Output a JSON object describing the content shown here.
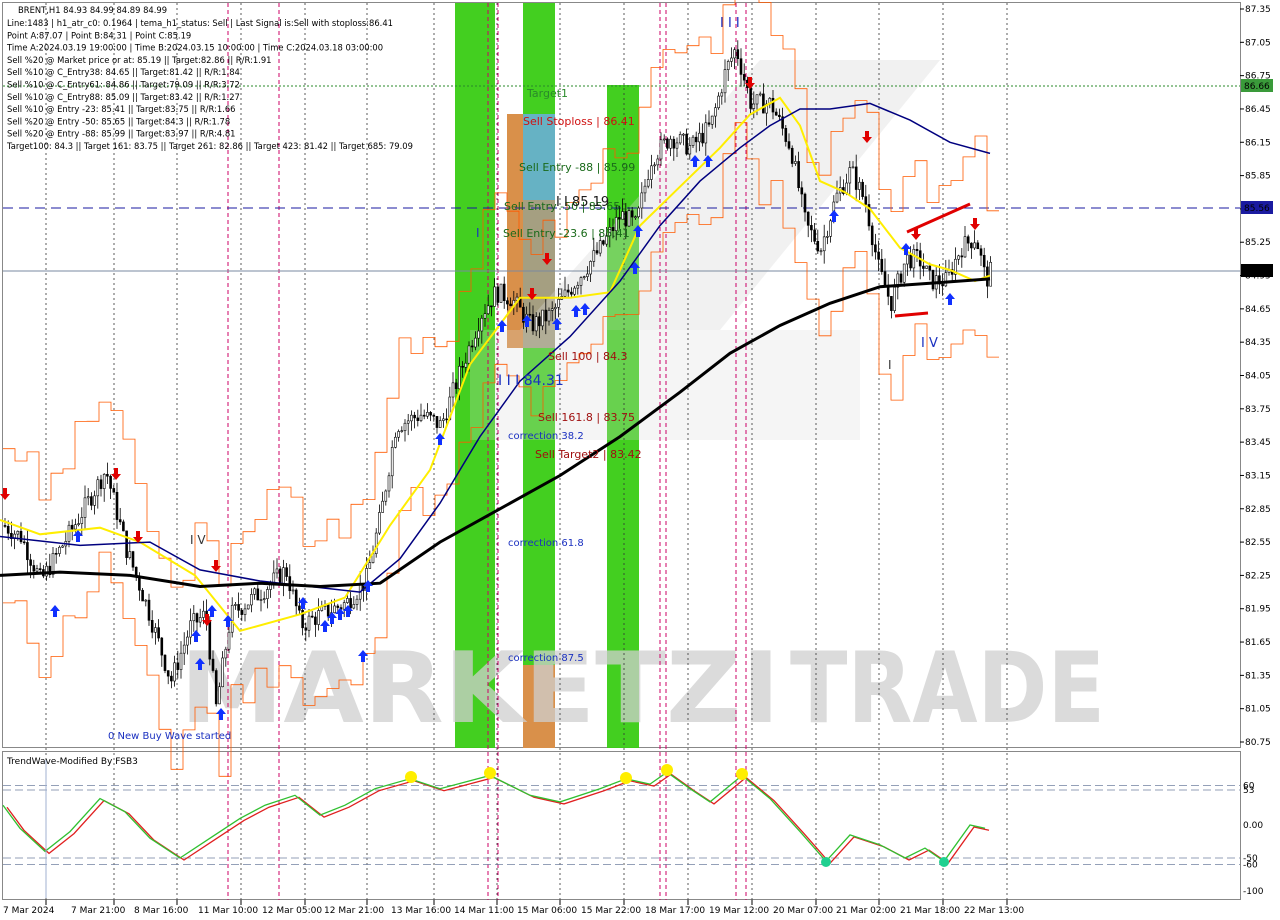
{
  "header": {
    "symbol": "BRENT,H1  84.93 84.99 84.89 84.99",
    "lines": [
      "Line:1483  |  h1_atr_c0: 0.1964  |  tema_h1_status: Sell  |  Last Signal is:Sell with stoploss:86.41",
      "Point A:87.07  |  Point B:84.31  |  Point C:85.19",
      "Time A:2024.03.19 19:00:00  |  Time B:2024.03.15 10:00:00  |  Time C:2024.03.18 03:00:00",
      "Sell %20 @ Market price or at: 85.19  ||  Target:82.86  ||  R/R:1.91",
      "Sell %10 @ C_Entry38: 84.65  ||  Target:81.42  ||  R/R:1.84",
      "Sell %10 @ C_Entry61: 84.86  ||  Target:79.09  ||  R/R:3.72",
      "Sell %10 @ C_Entry88: 85.09  ||  Target:83.42  ||  R/R:1.27",
      "Sell %10 @ Entry -23: 85.41  ||  Target:83.75  ||  R/R:1.66",
      "Sell %20 @ Entry -50: 85.65  ||  Target:84.3  ||  R/R:1.78",
      "Sell %20 @ Entry -88: 85.99  ||  Target:83.97  ||  R/R:4.81",
      "Target100: 84.3  ||  Target 161: 83.75  ||  Target 261: 82.86  ||  Target 423: 81.42  ||  Target 685: 79.09"
    ]
  },
  "watermark": {
    "left": "MARKETZI",
    "right": "TRADE"
  },
  "price_axis": {
    "ticks": [
      "87.35",
      "87.05",
      "86.75",
      "86.45",
      "86.15",
      "85.85",
      "85.55",
      "85.25",
      "84.95",
      "84.65",
      "84.35",
      "84.05",
      "83.75",
      "83.45",
      "83.15",
      "82.85",
      "82.55",
      "82.25",
      "81.95",
      "81.65",
      "81.35",
      "81.05",
      "80.75"
    ],
    "current_price": "84.99",
    "target_level": "86.66",
    "dashed_level": "85.56"
  },
  "time_axis": {
    "labels": [
      "7 Mar 2024",
      "7 Mar 21:00",
      "8 Mar 16:00",
      "11 Mar 10:00",
      "12 Mar 05:00",
      "12 Mar 21:00",
      "13 Mar 16:00",
      "14 Mar 11:00",
      "15 Mar 06:00",
      "15 Mar 22:00",
      "18 Mar 17:00",
      "19 Mar 12:00",
      "20 Mar 07:00",
      "21 Mar 02:00",
      "21 Mar 18:00",
      "22 Mar 13:00"
    ]
  },
  "annotations": {
    "target1": "Target1",
    "sell_stoploss": "Sell Stoploss | 86.41",
    "sell_entry_88": "Sell Entry -88 | 85.99",
    "sell_entry_50": "Sell Entry -50 | 85.65",
    "level_c": "I I 85.19",
    "sell_entry_23": "Sell Entry -23.6 | 85.41",
    "sell_100": "Sell 100 | 84.3",
    "level_b": "I I I 84.31",
    "sell_161": "Sell 161.8 | 83.75",
    "correction_38": "correction 38.2",
    "sell_target2": "Sell Target2 | 83.42",
    "correction_61": "correction 61.8",
    "correction_87": "correction 87.5",
    "new_buy_wave": "0 New Buy Wave started",
    "wave_iii": "I I I",
    "wave_iv": "I V",
    "wave_iv_left": "I V",
    "wave_i": "I",
    "wave_i2": "I"
  },
  "oscillator": {
    "title": "TrendWave-Modified By FSB3",
    "ticks": [
      "60",
      "53",
      "0.00",
      "-50",
      "-60",
      "-100"
    ]
  },
  "colors": {
    "green_band": "#39cc14",
    "orange_band": "#d9904a",
    "blue_band": "#6aaed6",
    "ma_yellow": "#ffee00",
    "ma_navy": "#00007f",
    "ma_black": "#000000",
    "envelope": "#ff5a00",
    "up_arrow": "#1030ff",
    "down_arrow": "#e00000"
  },
  "chart_data": {
    "type": "candlestick",
    "symbol": "BRENT",
    "timeframe": "H1",
    "ylim": [
      80.7,
      87.4
    ],
    "anchors": [
      [
        "7 Mar 2024",
        82.7
      ],
      [
        "7 Mar 21:00",
        82.55
      ],
      [
        "8 Mar 16:00",
        82.3
      ],
      [
        "11 Mar 10:00",
        81.4
      ],
      [
        "12 Mar 05:00",
        82.2
      ],
      [
        "12 Mar 21:00",
        82.1
      ],
      [
        "13 Mar 16:00",
        83.8
      ],
      [
        "14 Mar 11:00",
        84.9
      ],
      [
        "15 Mar 06:00",
        84.4
      ],
      [
        "15 Mar 22:00",
        85.2
      ],
      [
        "18 Mar 17:00",
        86.1
      ],
      [
        "19 Mar 12:00",
        86.6
      ],
      [
        "20 Mar 07:00",
        85.4
      ],
      [
        "21 Mar 02:00",
        85.6
      ],
      [
        "21 Mar 18:00",
        84.8
      ],
      [
        "22 Mar 13:00",
        84.99
      ]
    ],
    "moving_averages": [
      {
        "color": "yellow",
        "points": [
          [
            0,
            82.75
          ],
          [
            40,
            82.62
          ],
          [
            100,
            82.68
          ],
          [
            140,
            82.55
          ],
          [
            195,
            82.25
          ],
          [
            240,
            81.75
          ],
          [
            300,
            81.9
          ],
          [
            345,
            82.05
          ],
          [
            390,
            82.7
          ],
          [
            430,
            83.2
          ],
          [
            470,
            84.15
          ],
          [
            520,
            84.75
          ],
          [
            570,
            84.75
          ],
          [
            610,
            84.8
          ],
          [
            640,
            85.4
          ],
          [
            680,
            85.75
          ],
          [
            720,
            86.1
          ],
          [
            750,
            86.4
          ],
          [
            780,
            86.55
          ],
          [
            800,
            86.3
          ],
          [
            820,
            85.8
          ],
          [
            845,
            85.7
          ],
          [
            870,
            85.55
          ],
          [
            900,
            85.2
          ],
          [
            930,
            85.05
          ],
          [
            950,
            85.0
          ],
          [
            975,
            84.9
          ],
          [
            990,
            84.95
          ]
        ]
      },
      {
        "color": "navy",
        "points": [
          [
            0,
            82.6
          ],
          [
            80,
            82.52
          ],
          [
            150,
            82.55
          ],
          [
            200,
            82.3
          ],
          [
            260,
            82.2
          ],
          [
            310,
            82.15
          ],
          [
            360,
            82.1
          ],
          [
            400,
            82.4
          ],
          [
            440,
            82.9
          ],
          [
            480,
            83.5
          ],
          [
            520,
            84.0
          ],
          [
            570,
            84.4
          ],
          [
            620,
            84.9
          ],
          [
            660,
            85.4
          ],
          [
            700,
            85.8
          ],
          [
            740,
            86.1
          ],
          [
            770,
            86.3
          ],
          [
            800,
            86.45
          ],
          [
            830,
            86.45
          ],
          [
            870,
            86.5
          ],
          [
            910,
            86.35
          ],
          [
            950,
            86.15
          ],
          [
            990,
            86.05
          ]
        ]
      },
      {
        "color": "black",
        "points": [
          [
            0,
            82.25
          ],
          [
            60,
            82.28
          ],
          [
            130,
            82.25
          ],
          [
            200,
            82.15
          ],
          [
            260,
            82.18
          ],
          [
            320,
            82.15
          ],
          [
            380,
            82.18
          ],
          [
            440,
            82.55
          ],
          [
            500,
            82.85
          ],
          [
            560,
            83.15
          ],
          [
            620,
            83.5
          ],
          [
            680,
            83.9
          ],
          [
            730,
            84.25
          ],
          [
            780,
            84.5
          ],
          [
            830,
            84.7
          ],
          [
            880,
            84.85
          ],
          [
            930,
            84.88
          ],
          [
            990,
            84.92
          ]
        ]
      }
    ],
    "levels": [
      {
        "price": 86.66,
        "style": "dotted",
        "color": "green"
      },
      {
        "price": 85.56,
        "style": "dashed",
        "color": "navy"
      },
      {
        "price": 84.99,
        "style": "solid",
        "color": "gray"
      }
    ],
    "oscillator": {
      "name": "TrendWave-Modified By FSB3",
      "ylim": [
        -100,
        100
      ],
      "levels": [
        60,
        53,
        -50,
        -60
      ]
    }
  }
}
